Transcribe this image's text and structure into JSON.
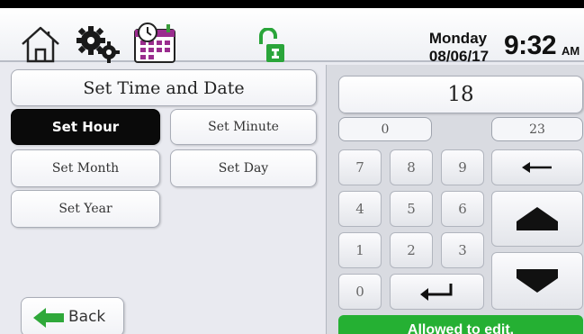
{
  "status_bar": {
    "icons": [
      "home-icon",
      "gear-icon",
      "calendar-icon",
      "unlocked-icon"
    ],
    "day": "Monday",
    "date": "08/06/17",
    "time": "9:32",
    "ampm": "AM"
  },
  "menu": {
    "title": "Set Time and Date",
    "buttons": {
      "set_hour": "Set Hour",
      "set_minute": "Set Minute",
      "set_month": "Set Month",
      "set_day": "Set Day",
      "set_year": "Set Year"
    },
    "selected": "Set Hour",
    "back_label": "Back"
  },
  "keypad": {
    "value": "18",
    "min": "0",
    "max": "23",
    "keys": [
      "7",
      "8",
      "9",
      "4",
      "5",
      "6",
      "1",
      "2",
      "3",
      "0"
    ],
    "icons": [
      "backspace-arrow-icon",
      "enter-icon",
      "increment-up-icon",
      "decrement-down-icon"
    ]
  },
  "status_message": "Allowed to edit.",
  "colors": {
    "selected_button": "#0a0a0a",
    "status_green": "#25b033",
    "lock_green": "#2aa53a",
    "back_arrow_green": "#2fa83a"
  }
}
